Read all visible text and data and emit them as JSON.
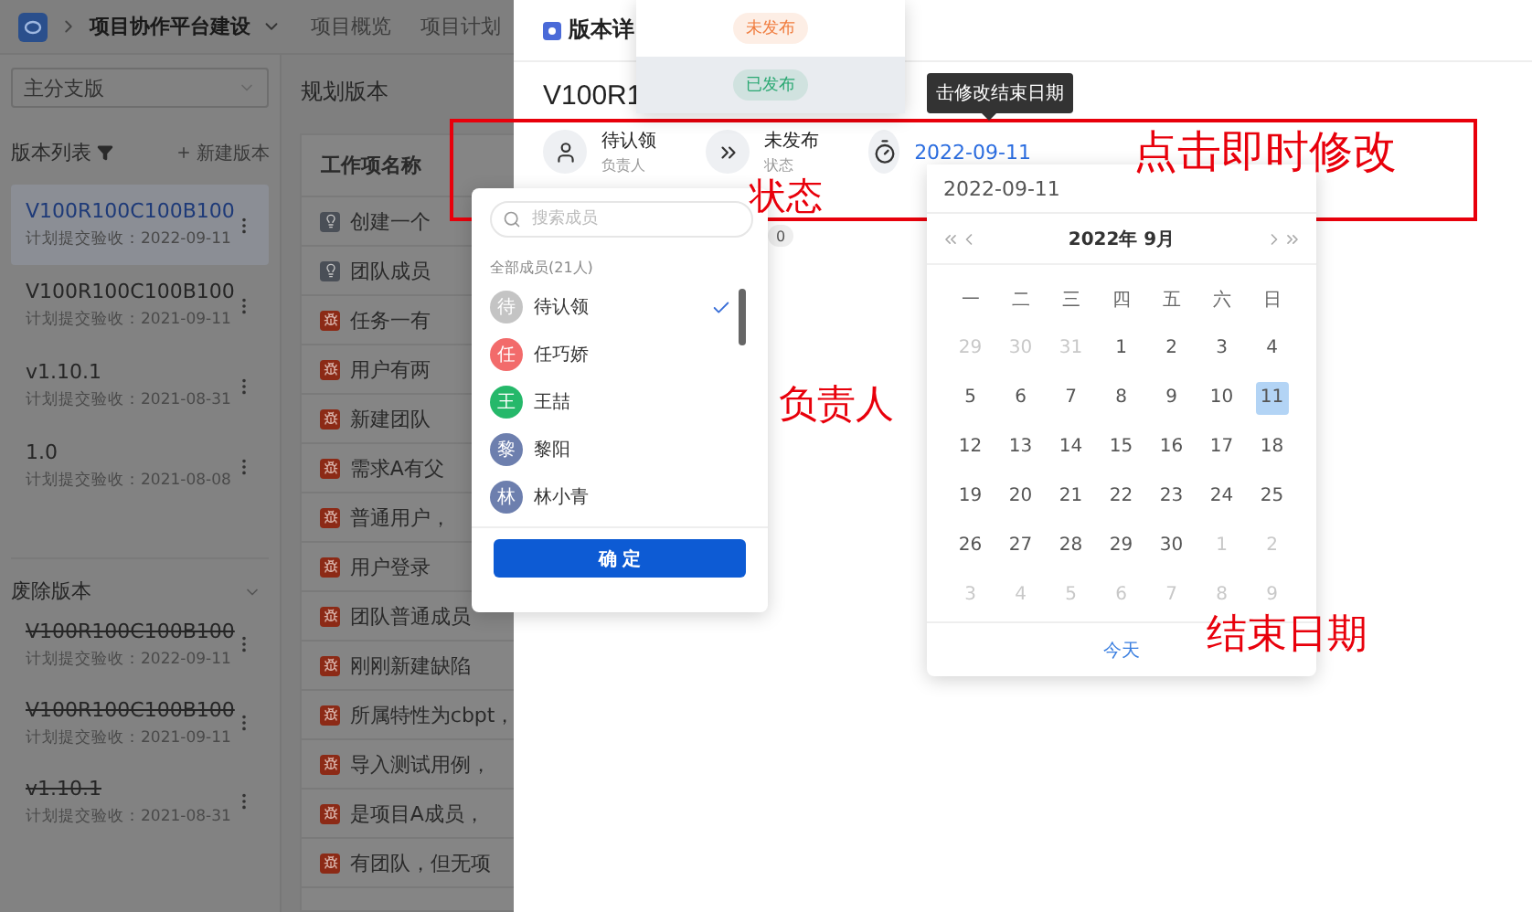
{
  "top_bar": {
    "project": "项目协作平台建设",
    "tabs": [
      {
        "label": "项目概览",
        "selected": false
      },
      {
        "label": "项目计划",
        "selected": false
      }
    ]
  },
  "sidebar": {
    "branch_select": "主分支版",
    "list_title": "版本列表",
    "new_button": "新建版本",
    "versions": [
      {
        "name": "V100R100C100B100",
        "date": "计划提交验收：2022-09-11",
        "selected": true
      },
      {
        "name": "V100R100C100B100",
        "date": "计划提交验收：2021-09-11",
        "selected": false
      },
      {
        "name": "v1.10.1",
        "date": "计划提交验收：2021-08-31",
        "selected": false
      },
      {
        "name": "1.0",
        "date": "计划提交验收：2021-08-08",
        "selected": false
      }
    ],
    "deprecated_title": "废除版本",
    "deprecated": [
      {
        "name": "V100R100C100B100",
        "date": "计划提交验收：2022-09-11"
      },
      {
        "name": "V100R100C100B100",
        "date": "计划提交验收：2021-09-11"
      },
      {
        "name": "v1.10.1",
        "date": "计划提交验收：2021-08-31"
      }
    ]
  },
  "main": {
    "title": "规划版本",
    "columns": [
      "工作项名称"
    ],
    "rows": [
      {
        "kind": "idea",
        "text": "创建一个"
      },
      {
        "kind": "idea",
        "text": "团队成员"
      },
      {
        "kind": "bug",
        "text": "任务一有"
      },
      {
        "kind": "bug",
        "text": "用户有两"
      },
      {
        "kind": "bug",
        "text": "新建团队"
      },
      {
        "kind": "bug",
        "text": "需求A有父"
      },
      {
        "kind": "bug",
        "text": "普通用户，"
      },
      {
        "kind": "bug",
        "text": "用户登录"
      },
      {
        "kind": "bug",
        "text": "团队普通成员"
      },
      {
        "kind": "bug",
        "text": "刚刚新建缺陷"
      },
      {
        "kind": "bug",
        "text": "所属特性为cbpt，"
      },
      {
        "kind": "bug",
        "text": "导入测试用例，"
      },
      {
        "kind": "bug",
        "text": "是项目A成员，"
      },
      {
        "kind": "bug",
        "text": "有团队，但无项"
      }
    ]
  },
  "drawer": {
    "header": "版本详",
    "title": "V100R1",
    "badge": "0",
    "fields": [
      {
        "kind": "owner",
        "value": "待认领",
        "label": "负责人"
      },
      {
        "kind": "status",
        "value": "未发布",
        "label": "状态"
      },
      {
        "kind": "date",
        "value": "2022-09-11"
      }
    ]
  },
  "status_menu": {
    "options": [
      {
        "label": "未发布",
        "color": "#f07c3e",
        "selected": false
      },
      {
        "label": "已发布",
        "color": "#2aa872",
        "selected": true
      }
    ]
  },
  "tooltip": "击修改结束日期",
  "member_picker": {
    "placeholder": "搜索成员",
    "count_label": "全部成员(21人)",
    "confirm": "确 定",
    "members": [
      {
        "initial": "待",
        "name": "待认领",
        "color": "#c4c4c4",
        "checked": true
      },
      {
        "initial": "任",
        "name": "任巧娇",
        "color": "#f26b6b",
        "checked": false
      },
      {
        "initial": "王",
        "name": "王喆",
        "color": "#25b86a",
        "checked": false
      },
      {
        "initial": "黎",
        "name": "黎阳",
        "color": "#6d7fae",
        "checked": false
      },
      {
        "initial": "林",
        "name": "林小青",
        "color": "#6d7fae",
        "checked": false
      }
    ]
  },
  "date_picker": {
    "value": "2022-09-11",
    "month_label": "2022年 9月",
    "today": "今天",
    "weekdays": [
      "一",
      "二",
      "三",
      "四",
      "五",
      "六",
      "日"
    ],
    "days": [
      {
        "label": "29",
        "muted": true,
        "selected": false
      },
      {
        "label": "30",
        "muted": true,
        "selected": false
      },
      {
        "label": "31",
        "muted": true,
        "selected": false
      },
      {
        "label": "1",
        "muted": false,
        "selected": false
      },
      {
        "label": "2",
        "muted": false,
        "selected": false
      },
      {
        "label": "3",
        "muted": false,
        "selected": false
      },
      {
        "label": "4",
        "muted": false,
        "selected": false
      },
      {
        "label": "5",
        "muted": false,
        "selected": false
      },
      {
        "label": "6",
        "muted": false,
        "selected": false
      },
      {
        "label": "7",
        "muted": false,
        "selected": false
      },
      {
        "label": "8",
        "muted": false,
        "selected": false
      },
      {
        "label": "9",
        "muted": false,
        "selected": false
      },
      {
        "label": "10",
        "muted": false,
        "selected": false
      },
      {
        "label": "11",
        "muted": false,
        "selected": true
      },
      {
        "label": "12",
        "muted": false,
        "selected": false
      },
      {
        "label": "13",
        "muted": false,
        "selected": false
      },
      {
        "label": "14",
        "muted": false,
        "selected": false
      },
      {
        "label": "15",
        "muted": false,
        "selected": false
      },
      {
        "label": "16",
        "muted": false,
        "selected": false
      },
      {
        "label": "17",
        "muted": false,
        "selected": false
      },
      {
        "label": "18",
        "muted": false,
        "selected": false
      },
      {
        "label": "19",
        "muted": false,
        "selected": false
      },
      {
        "label": "20",
        "muted": false,
        "selected": false
      },
      {
        "label": "21",
        "muted": false,
        "selected": false
      },
      {
        "label": "22",
        "muted": false,
        "selected": false
      },
      {
        "label": "23",
        "muted": false,
        "selected": false
      },
      {
        "label": "24",
        "muted": false,
        "selected": false
      },
      {
        "label": "25",
        "muted": false,
        "selected": false
      },
      {
        "label": "26",
        "muted": false,
        "selected": false
      },
      {
        "label": "27",
        "muted": false,
        "selected": false
      },
      {
        "label": "28",
        "muted": false,
        "selected": false
      },
      {
        "label": "29",
        "muted": false,
        "selected": false
      },
      {
        "label": "30",
        "muted": false,
        "selected": false
      },
      {
        "label": "1",
        "muted": true,
        "selected": false
      },
      {
        "label": "2",
        "muted": true,
        "selected": false
      },
      {
        "label": "3",
        "muted": true,
        "selected": false
      },
      {
        "label": "4",
        "muted": true,
        "selected": false
      },
      {
        "label": "5",
        "muted": true,
        "selected": false
      },
      {
        "label": "6",
        "muted": true,
        "selected": false
      },
      {
        "label": "7",
        "muted": true,
        "selected": false
      },
      {
        "label": "8",
        "muted": true,
        "selected": false
      },
      {
        "label": "9",
        "muted": true,
        "selected": false
      }
    ]
  },
  "annotations": [
    {
      "kind": "frame"
    },
    {
      "kind": "label",
      "text": "点击即时修改"
    },
    {
      "kind": "label",
      "text": "状态"
    },
    {
      "kind": "label",
      "text": "负责人"
    },
    {
      "kind": "label",
      "text": "结束日期"
    }
  ]
}
